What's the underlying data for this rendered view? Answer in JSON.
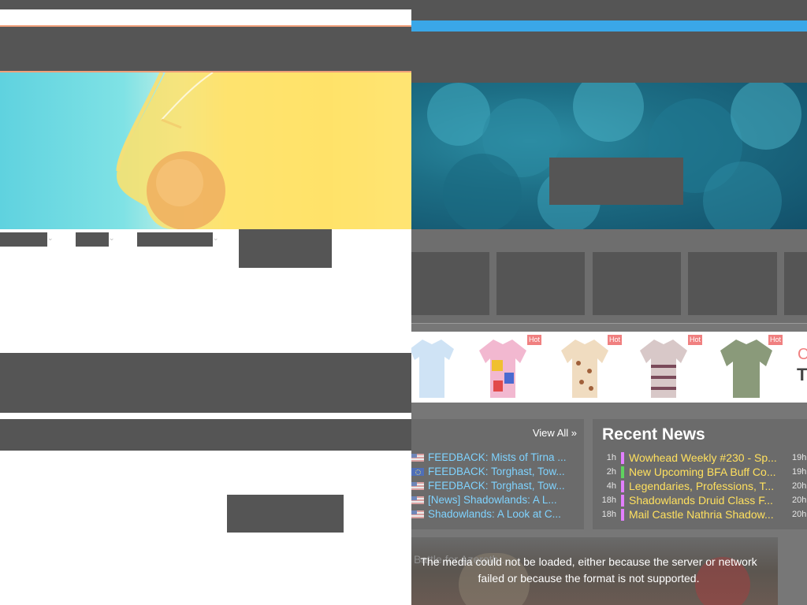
{
  "ad": {
    "hot_label": "Hot",
    "edge_text_1": "C",
    "edge_text_2": "T"
  },
  "forum": {
    "view_all_label": "View All »",
    "posts": [
      {
        "flag": "us",
        "title": "FEEDBACK: Mists of Tirna ..."
      },
      {
        "flag": "eu",
        "title": "FEEDBACK: Torghast, Tow..."
      },
      {
        "flag": "us",
        "title": "FEEDBACK: Torghast, Tow..."
      },
      {
        "flag": "us",
        "title": "[News] Shadowlands: A L..."
      },
      {
        "flag": "us",
        "title": "Shadowlands: A Look at C..."
      }
    ]
  },
  "news": {
    "title": "Recent News",
    "items": [
      {
        "time": "1h",
        "title": "Wowhead Weekly #230 - Sp...",
        "right": "19h",
        "color": "#e27fff"
      },
      {
        "time": "2h",
        "title": "New Upcoming BFA Buff Co...",
        "right": "19h",
        "color": "#5fd35f"
      },
      {
        "time": "4h",
        "title": "Legendaries, Professions, T...",
        "right": "20h",
        "color": "#e27fff"
      },
      {
        "time": "18h",
        "title": "Shadowlands Druid Class F...",
        "right": "20h",
        "color": "#e27fff"
      },
      {
        "time": "18h",
        "title": "Mail Castle Nathria Shadow...",
        "right": "20h",
        "color": "#e27fff"
      }
    ]
  },
  "video": {
    "ghost_text": "Battle for Azeroth ...",
    "error_message": "The media could not be loaded, either because the server or network failed or because the format is not supported."
  },
  "colors": {
    "placeholder": "#555555",
    "accent_orange": "#f0a07a",
    "accent_blue": "#3aa7e8",
    "link_blue": "#7fd3ff",
    "news_yellow": "#ffe05e"
  }
}
